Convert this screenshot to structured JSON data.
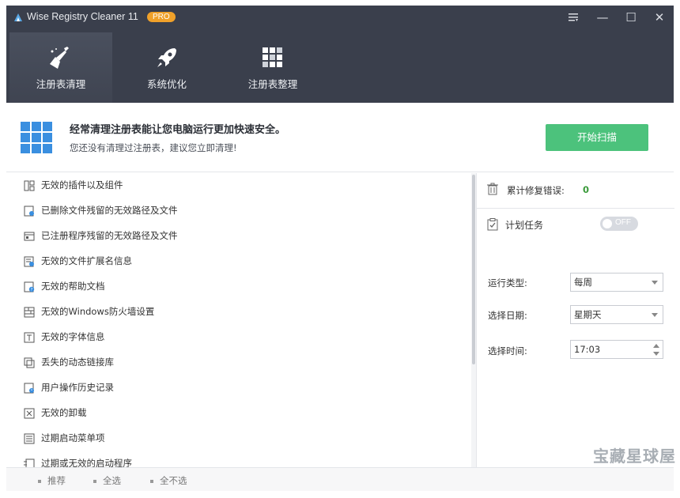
{
  "app": {
    "title": "Wise Registry Cleaner 11",
    "badge": "PRO"
  },
  "window": {
    "menu": "☰",
    "minimize": "—",
    "maximize": "☐",
    "close": "✕"
  },
  "nav": [
    {
      "label": "注册表清理",
      "icon": "broom-icon"
    },
    {
      "label": "系统优化",
      "icon": "rocket-icon"
    },
    {
      "label": "注册表整理",
      "icon": "grid-icon"
    }
  ],
  "banner": {
    "title": "经常清理注册表能让您电脑运行更加快速安全。",
    "subtitle": "您还没有清理过注册表，建议您立即清理!",
    "scan_button": "开始扫描"
  },
  "list": [
    "无效的插件以及组件",
    "已删除文件残留的无效路径及文件",
    "已注册程序残留的无效路径及文件",
    "无效的文件扩展名信息",
    "无效的帮助文档",
    "无效的Windows防火墙设置",
    "无效的字体信息",
    "丢失的动态链接库",
    "用户操作历史记录",
    "无效的卸载",
    "过期启动菜单项",
    "过期或无效的启动程序"
  ],
  "stats": {
    "label": "累计修复错误:",
    "value": "0"
  },
  "schedule": {
    "label": "计划任务",
    "toggle": "OFF",
    "run_type_label": "运行类型:",
    "run_type_value": "每周",
    "day_label": "选择日期:",
    "day_value": "星期天",
    "time_label": "选择时间:",
    "time_value": "17:03"
  },
  "footer": {
    "recommend": "推荐",
    "select_all": "全选",
    "select_none": "全不选"
  },
  "watermark": "宝藏星球屋",
  "colors": {
    "header": "#3a3f4c",
    "accent_green": "#4cc27c",
    "badge": "#f0a12a"
  }
}
